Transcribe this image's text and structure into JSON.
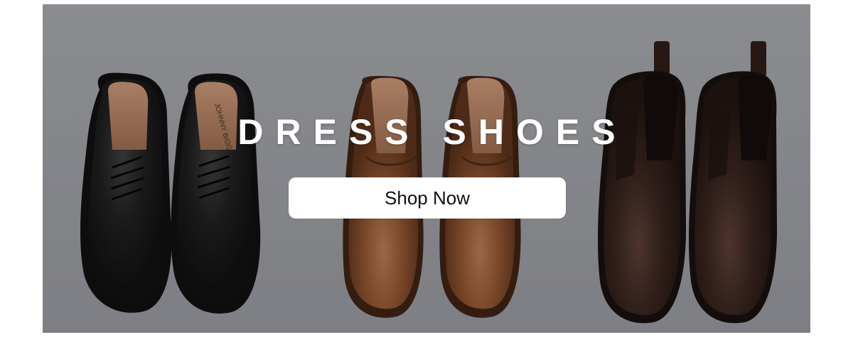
{
  "banner": {
    "headline": "DRESS SHOES",
    "cta_label": "Shop Now",
    "brand_stamp": "JOHNNY BIGG",
    "background_color": "#9b9da0",
    "button_color": "#ffffff",
    "products": [
      {
        "name": "black-derby-shoes",
        "color": "#141414"
      },
      {
        "name": "tan-oxford-shoes",
        "color": "#7a4424"
      },
      {
        "name": "brown-chelsea-boots",
        "color": "#2b1a14"
      }
    ]
  }
}
